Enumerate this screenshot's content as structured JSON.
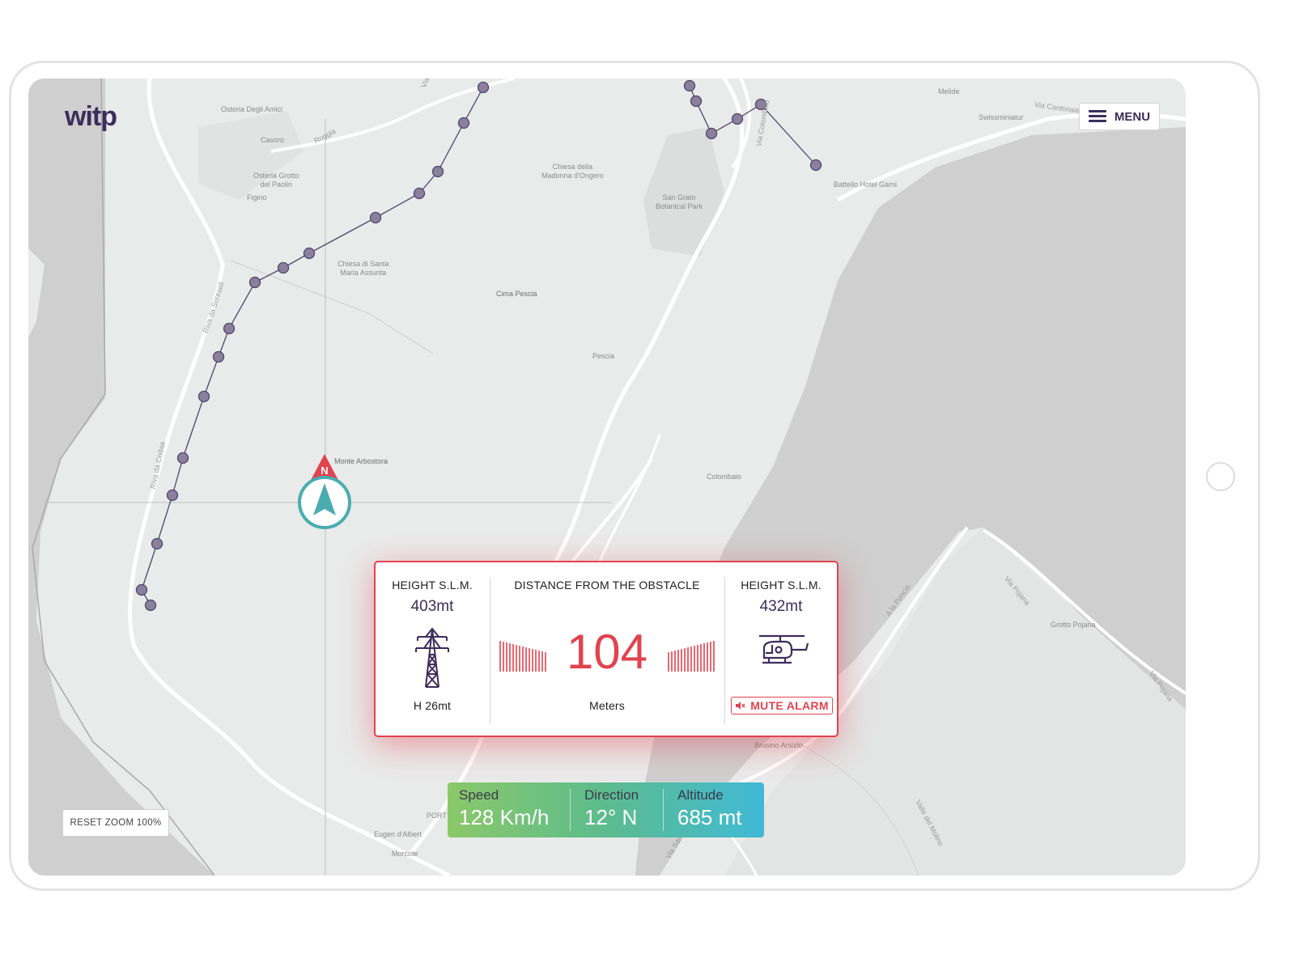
{
  "app": {
    "logo_text_a": "wit",
    "logo_text_b": "p"
  },
  "toolbar": {
    "menu_label": "MENU",
    "reset_zoom_label": "RESET ZOOM 100%"
  },
  "compass": {
    "north_label": "N"
  },
  "map": {
    "places": {
      "osteria_amici": "Osteria Degli Amici",
      "casoro": "Casoro",
      "osteria_paolin": "Osteria Grotto\ndel Paolin",
      "figino": "Figino",
      "chiesa_madonna": "Chiesa della\nMadonna d'Ongero",
      "san_grato": "San Grato\nBotanical Park",
      "chiesa_santa_maria": "Chiesa di Santa\nMaria Assunta",
      "cima_pescia": "Cima Pescia",
      "pescia": "Pescia",
      "monte_arbostora": "Monte Arbostora",
      "colombaio": "Colombaio",
      "melide": "Melide",
      "swissminiatur": "Swissminiatur",
      "batello": "Battello Hotel Garni",
      "brusino": "Brusino Arsizio",
      "grotto_pojana": "Grotto Pojana",
      "eugen": "Eugen d'Albert",
      "morcote": "Morcote",
      "port": "PORT"
    },
    "roads": {
      "roggia": "Roggia",
      "via_cantonale": "Via Cantonale",
      "via_colombaio": "Via Colombaio",
      "riva_soresell": "Riva da Soresell",
      "riva_codaa": "Riva da Codaa",
      "a_la_poncia": "A la Poncia",
      "via_pojana_1": "Via Pojana",
      "via_pojana_2": "Via Pojana",
      "valle_molino": "Valle del Molino",
      "via_san": "Via San",
      "via_top": "Via"
    }
  },
  "alert": {
    "obstacle": {
      "label": "HEIGHT S.L.M.",
      "height": "403mt",
      "obstacle_height": "H 26mt",
      "icon": "power-pylon-icon"
    },
    "distance": {
      "label": "DISTANCE FROM THE OBSTACLE",
      "value": "104",
      "unit": "Meters"
    },
    "aircraft": {
      "label": "HEIGHT S.L.M.",
      "height": "432mt",
      "icon": "helicopter-icon",
      "mute_label": "MUTE ALARM"
    },
    "colors": {
      "alert": "#e2434e",
      "text": "#3a2e5c"
    }
  },
  "stats": {
    "speed": {
      "label": "Speed",
      "value": "128 Km/h"
    },
    "direction": {
      "label": "Direction",
      "value": "12° N"
    },
    "altitude": {
      "label": "Altitude",
      "value": "685 mt"
    }
  }
}
